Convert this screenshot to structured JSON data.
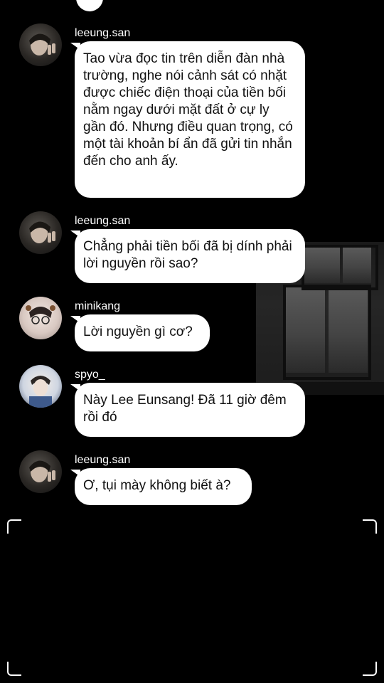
{
  "messages": [
    {
      "username": "leeung.san",
      "avatar": "boy-peace-sign-avatar",
      "text": "Tao vừa đọc tin trên diễn đàn nhà trường, nghe nói cảnh sát có nhặt được chiếc điện thoại của tiền bối nằm ngay dưới mặt đất ở cự ly gần đó. Nhưng điều quan trọng, có một tài khoản bí ẩn đã gửi tin nhắn đến cho anh ấy."
    },
    {
      "username": "leeung.san",
      "avatar": "boy-peace-sign-avatar",
      "text": " Chẳng phải tiền bối đã bị dính phải lời nguyền rồi sao?"
    },
    {
      "username": "minikang",
      "avatar": "boy-glasses-filter-avatar",
      "text": "Lời nguyền gì cơ?"
    },
    {
      "username": "spyo_",
      "avatar": "boy-overalls-avatar",
      "text": "Này Lee Eunsang! Đã 11 giờ đêm rồi đó"
    },
    {
      "username": "leeung.san",
      "avatar": "boy-peace-sign-avatar",
      "text": "Ơ, tụi mày không biết à?"
    }
  ],
  "colors": {
    "background": "#000000",
    "bubble": "#ffffff",
    "bubble_text": "#111111",
    "username": "#ffffff"
  }
}
